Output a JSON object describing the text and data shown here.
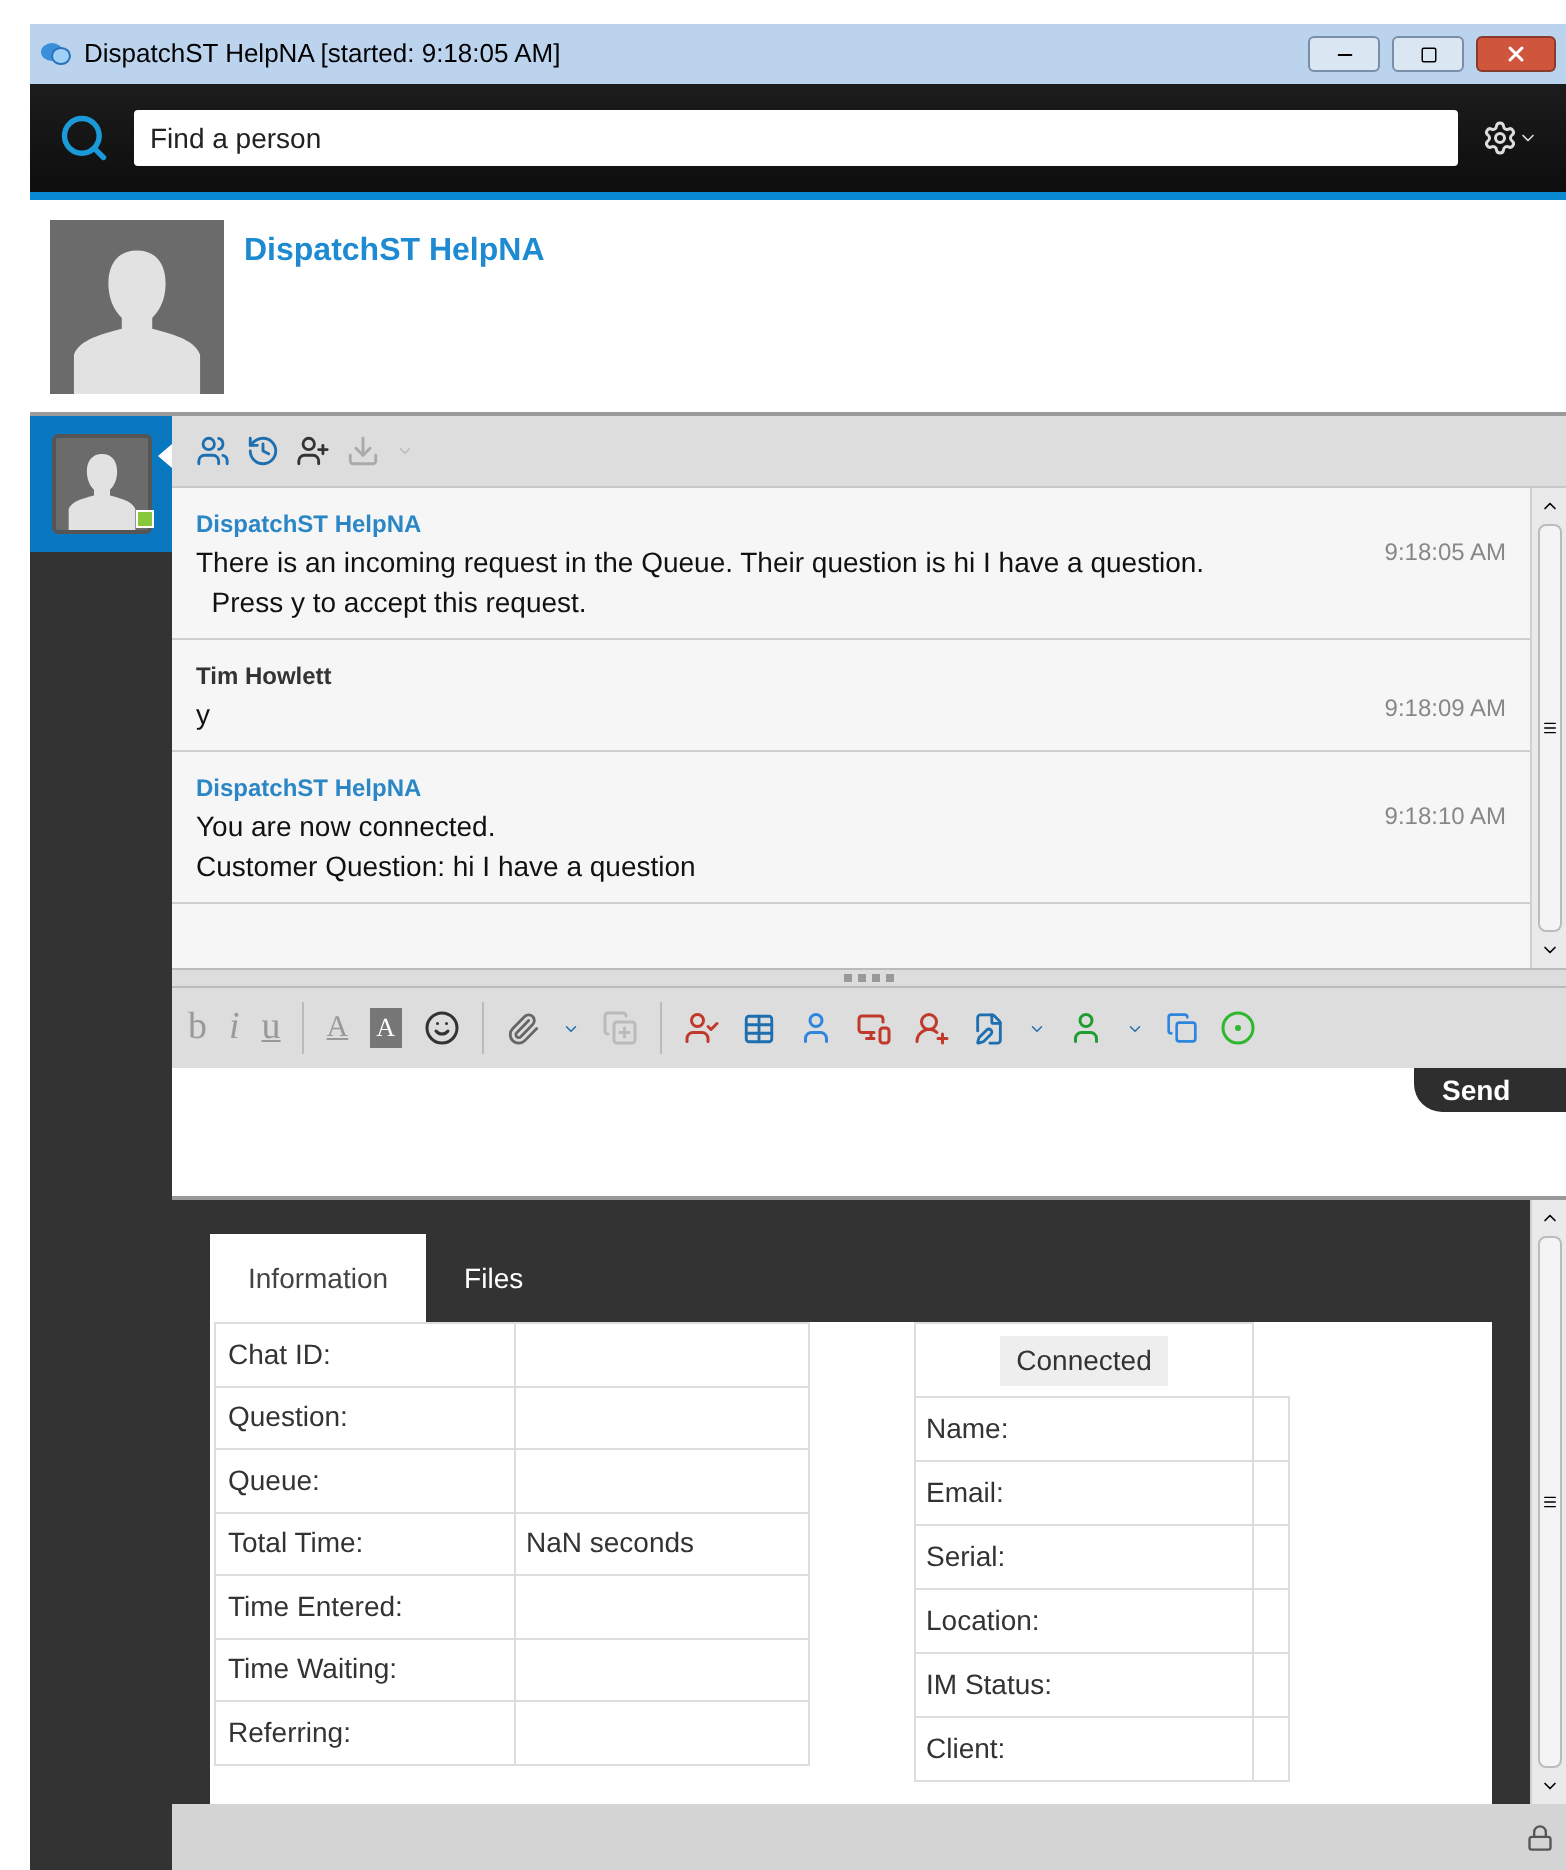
{
  "window": {
    "title": "DispatchST HelpNA [started: 9:18:05 AM]"
  },
  "search": {
    "placeholder": "Find a person"
  },
  "profile": {
    "name": "DispatchST HelpNA"
  },
  "messages": [
    {
      "kind": "system",
      "sender": "DispatchST HelpNA",
      "lines": [
        "There is an incoming request in the Queue. Their question is hi I have a question.",
        "  Press y to accept this request."
      ],
      "time": "9:18:05 AM"
    },
    {
      "kind": "user",
      "sender": "Tim Howlett",
      "lines": [
        "y"
      ],
      "time": "9:18:09 AM"
    },
    {
      "kind": "system",
      "sender": "DispatchST HelpNA",
      "lines": [
        "You are now connected.",
        "Customer Question: hi I have a question"
      ],
      "time": "9:18:10 AM"
    }
  ],
  "compose": {
    "send": "Send",
    "format_buttons": [
      {
        "kind": "bold",
        "label": "b"
      },
      {
        "kind": "italic",
        "label": "i"
      },
      {
        "kind": "underline",
        "label": "u"
      },
      {
        "kind": "color",
        "label": "A"
      },
      {
        "kind": "highlight",
        "label": "A"
      }
    ]
  },
  "info_tabs": [
    {
      "label": "Information",
      "selected": true
    },
    {
      "label": "Files",
      "selected": false
    }
  ],
  "info_table": [
    {
      "label": "Chat ID:"
    },
    {
      "label": "Question:"
    },
    {
      "label": "Queue:"
    },
    {
      "label": "Total Time:",
      "value": "NaN seconds"
    },
    {
      "label": "Time Entered:"
    },
    {
      "label": "Time Waiting:"
    },
    {
      "label": "Referring:"
    }
  ],
  "customer": {
    "status": "Connected",
    "fields": [
      {
        "label": "Name:"
      },
      {
        "label": "Email:"
      },
      {
        "label": "Serial:"
      },
      {
        "label": "Location:"
      },
      {
        "label": "IM Status:"
      },
      {
        "label": "Client:"
      }
    ]
  }
}
